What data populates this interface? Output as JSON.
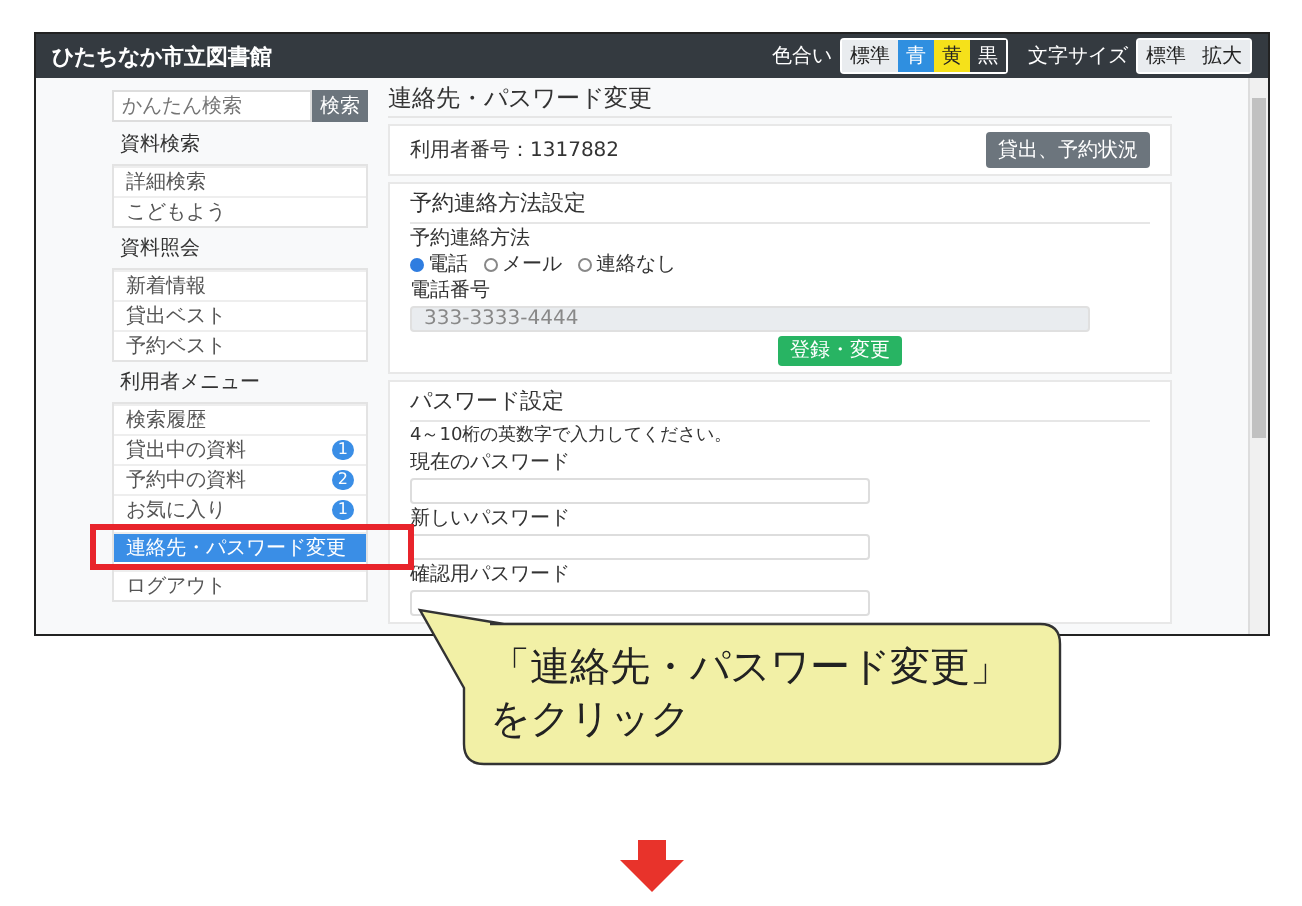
{
  "header": {
    "title": "ひたちなか市立図書館",
    "color_label": "色合い",
    "color_options": [
      {
        "label": "標準",
        "color": "#e9ecef"
      },
      {
        "label": "青",
        "color": "#2f8fe0"
      },
      {
        "label": "黄",
        "color": "#f5e11a"
      },
      {
        "label": "黒",
        "color": "#343a40"
      }
    ],
    "size_label": "文字サイズ",
    "size_options": [
      {
        "label": "標準"
      },
      {
        "label": "拡大"
      }
    ]
  },
  "sidebar": {
    "search": {
      "placeholder": "かんたん検索",
      "button": "検索"
    },
    "sections": [
      {
        "heading": "資料検索",
        "items": [
          {
            "label": "詳細検索",
            "selected": false
          },
          {
            "label": "こどもよう",
            "selected": false
          }
        ]
      },
      {
        "heading": "資料照会",
        "items": [
          {
            "label": "新着情報",
            "selected": false
          },
          {
            "label": "貸出ベスト",
            "selected": false
          },
          {
            "label": "予約ベスト",
            "selected": false
          }
        ]
      },
      {
        "heading": "利用者メニュー",
        "items": [
          {
            "label": "検索履歴",
            "selected": false
          },
          {
            "label": "貸出中の資料",
            "selected": false,
            "badge": "1"
          },
          {
            "label": "予約中の資料",
            "selected": false,
            "badge": "2"
          },
          {
            "label": "お気に入り",
            "selected": false,
            "badge": "1"
          },
          {
            "label": "連絡先・パスワード変更",
            "selected": true
          },
          {
            "label": "ログアウト",
            "selected": false
          }
        ]
      }
    ]
  },
  "main": {
    "title": "連絡先・パスワード変更",
    "user_card": {
      "user_number": "利用者番号：1317882",
      "button": "貸出、予約状況"
    },
    "contact_card": {
      "heading": "予約連絡方法設定",
      "method_label": "予約連絡方法",
      "methods": [
        {
          "label": "電話",
          "selected": true
        },
        {
          "label": "メール",
          "selected": false
        },
        {
          "label": "連絡なし",
          "selected": false
        }
      ],
      "phone_label": "電話番号",
      "phone_value": "333-3333-4444",
      "phone_disabled": true,
      "submit": "登録・変更"
    },
    "password_card": {
      "heading": "パスワード設定",
      "note": "4～10桁の英数字で入力してください。",
      "fields": [
        {
          "label": "現在のパスワード"
        },
        {
          "label": "新しいパスワード"
        },
        {
          "label": "確認用パスワード"
        }
      ]
    }
  },
  "callout": {
    "lines": [
      "「連絡先・パスワード変更」",
      "をクリック"
    ]
  }
}
